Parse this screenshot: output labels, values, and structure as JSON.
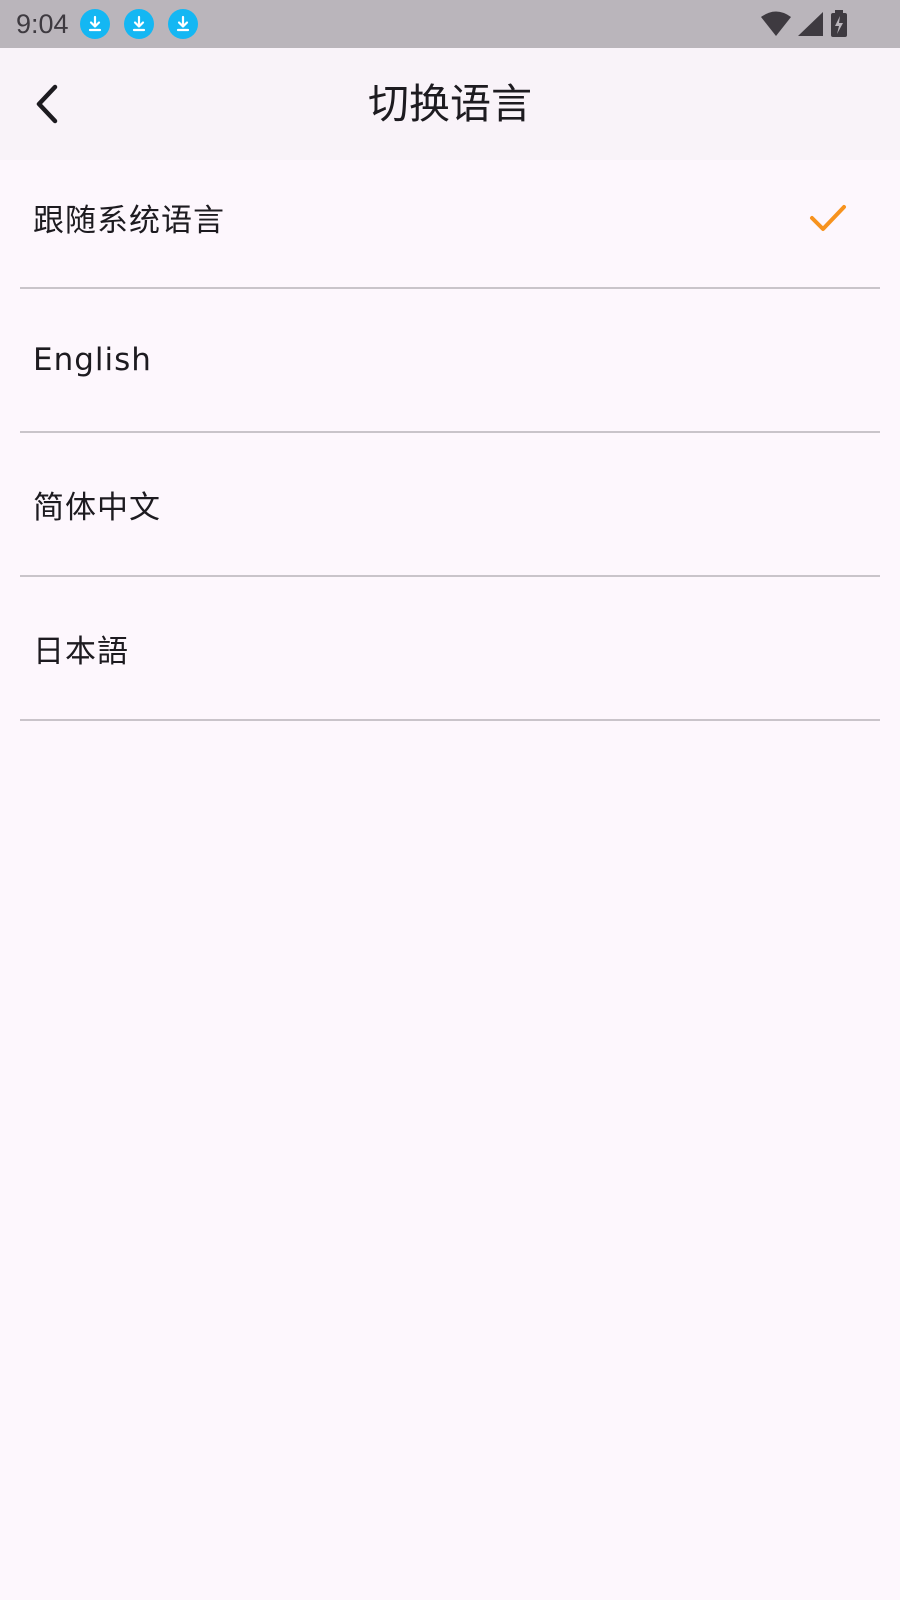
{
  "status_bar": {
    "time": "9:04",
    "notification_icons": [
      "download-icon",
      "download-icon",
      "download-icon"
    ],
    "right_icons": [
      "wifi-icon",
      "cellular-signal-icon",
      "battery-charging-icon"
    ],
    "notification_color": "#14b7f3"
  },
  "app_bar": {
    "title": "切换语言",
    "back_icon": "chevron-left-icon"
  },
  "languages": [
    {
      "label": "跟随系统语言",
      "selected": true
    },
    {
      "label": "English",
      "selected": false
    },
    {
      "label": "简体中文",
      "selected": false
    },
    {
      "label": "日本語",
      "selected": false
    }
  ],
  "colors": {
    "check": "#f7931e",
    "background": "#fdf7fd",
    "app_bar": "#f9f3f9",
    "status_bar": "#bab5bb",
    "divider": "#c9c4ca"
  }
}
